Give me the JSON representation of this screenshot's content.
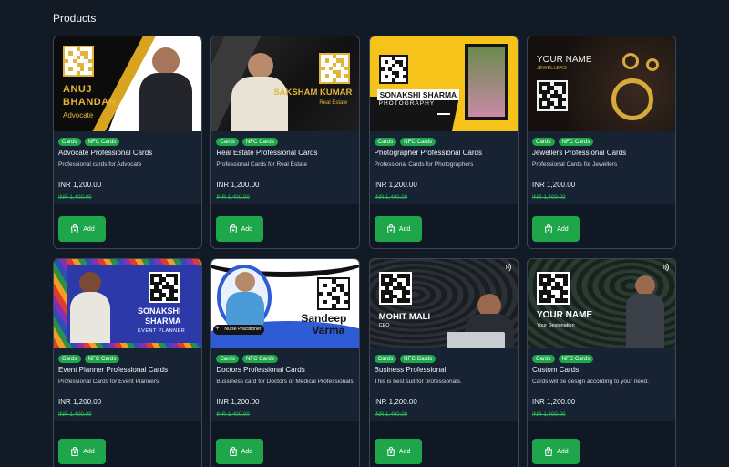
{
  "page": {
    "heading": "Products"
  },
  "products": [
    {
      "name": "Advocate Professional Cards",
      "desc": "Professional cards for Advocate",
      "price": "INR 1,200.00",
      "old_price": "INR 1,400.00",
      "tags": [
        "Cards",
        "NFC Cards"
      ],
      "add_label": "Add",
      "thumb": {
        "line1": "ANUJ",
        "line2": "BHANDARI",
        "line3": "Advocate"
      }
    },
    {
      "name": "Real Estate Professional Cards",
      "desc": "Professional Cards for Real Estate",
      "price": "INR 1,200.00",
      "old_price": "INR 1,400.00",
      "tags": [
        "Cards",
        "NFC Cards"
      ],
      "add_label": "Add",
      "thumb": {
        "line1": "SAKSHAM KUMAR",
        "line2": "Real Estate"
      }
    },
    {
      "name": "Photographer Professional Cards",
      "desc": "Professional Cards for Photographers",
      "price": "INR 1,200.00",
      "old_price": "INR 1,400.00",
      "tags": [
        "Cards",
        "NFC Cards"
      ],
      "add_label": "Add",
      "thumb": {
        "line1": "SONAKSHI SHARMA",
        "line2": "PHOTOGRAPHY"
      }
    },
    {
      "name": "Jewellers Professional Cards",
      "desc": "Professional Cards for Jewellers",
      "price": "INR 1,200.00",
      "old_price": "INR 1,400.00",
      "tags": [
        "Cards",
        "NFC Cards"
      ],
      "add_label": "Add",
      "thumb": {
        "line1": "YOUR NAME",
        "line2": "JEWELLERS"
      }
    },
    {
      "name": "Event Planner Professional Cards",
      "desc": "Professional Cards for Event Planners",
      "price": "INR 1,200.00",
      "old_price": "INR 1,400.00",
      "tags": [
        "Cards",
        "NFC Cards"
      ],
      "add_label": "Add",
      "thumb": {
        "line1": "SONAKSHI",
        "line2": "SHARMA",
        "line3": "EVENT PLANNER"
      }
    },
    {
      "name": "Doctors Professional Cards",
      "desc": "Bussiness card for Doctors or Medical Professionals",
      "price": "INR 1,200.00",
      "old_price": "INR 1,400.00",
      "tags": [
        "Cards",
        "NFC Cards"
      ],
      "add_label": "Add",
      "thumb": {
        "line1": "Sandeep",
        "line2": "Varma",
        "line3": "Nurse Practitioner"
      }
    },
    {
      "name": "Business Professional",
      "desc": "This is best suit for professionals.",
      "price": "INR 1,200.00",
      "old_price": "INR 1,400.00",
      "tags": [
        "Cards",
        "NFC Cards"
      ],
      "add_label": "Add",
      "thumb": {
        "line1": "MOHIT MALI",
        "line2": "CEO"
      }
    },
    {
      "name": "Custom Cards",
      "desc": "Cards will be design according to your need.",
      "price": "INR 1,200.00",
      "old_price": "INR 1,400.00",
      "tags": [
        "Cards",
        "NFC Cards"
      ],
      "add_label": "Add",
      "thumb": {
        "line1": "YOUR NAME",
        "line2": "Your Designation"
      }
    }
  ],
  "colors": {
    "accent": "#1ea64a",
    "background": "#121a26",
    "card_border": "#3a4656"
  }
}
